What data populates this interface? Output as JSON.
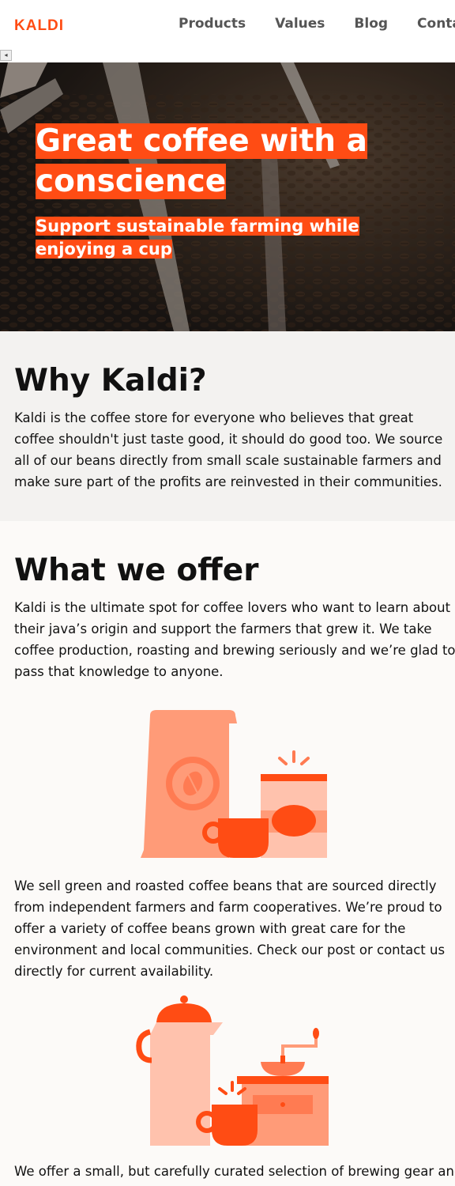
{
  "brand": {
    "logo": "KALDI",
    "accent": "#ff4c14"
  },
  "nav": {
    "items": [
      "Products",
      "Values",
      "Blog",
      "Contact"
    ]
  },
  "toggle": {
    "glyph": "◂"
  },
  "hero": {
    "title": "Great coffee with a conscience",
    "subtitle": "Support sustainable farming while enjoying a cup"
  },
  "why": {
    "heading": "Why Kaldi?",
    "text": "Kaldi is the coffee store for everyone who believes that great coffee shouldn't just taste good, it should do good too. We source all of our beans directly from small scale sustainable farmers and make sure part of the profits are reinvested in their communities."
  },
  "offer": {
    "heading": "What we offer",
    "intro": "Kaldi is the ultimate spot for coffee lovers who want to learn about their java’s origin and support the farmers that grew it. We take coffee production, roasting and brewing seriously and we’re glad to pass that knowledge to anyone.",
    "beans_text": "We sell green and roasted coffee beans that are sourced directly from independent farmers and farm cooperatives. We’re proud to offer a variety of coffee beans grown with great care for the environment and local communities. Check our post or contact us directly for current availability.",
    "gear_text": "We offer a small, but carefully curated selection of brewing gear and"
  }
}
